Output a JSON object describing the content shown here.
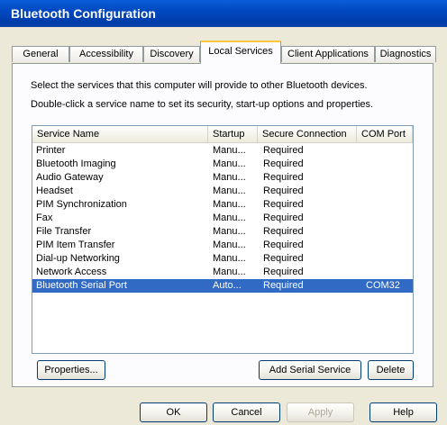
{
  "window": {
    "title": "Bluetooth Configuration"
  },
  "tabs": [
    {
      "label": "General"
    },
    {
      "label": "Accessibility"
    },
    {
      "label": "Discovery"
    },
    {
      "label": "Local Services"
    },
    {
      "label": "Client Applications"
    },
    {
      "label": "Diagnostics"
    }
  ],
  "panel": {
    "desc1": "Select the services that this computer will provide to other Bluetooth devices.",
    "desc2": "Double-click a service name to set its security, start-up options and properties."
  },
  "list": {
    "columns": [
      "Service Name",
      "Startup",
      "Secure Connection",
      "COM Port"
    ],
    "rows": [
      {
        "name": "Printer",
        "startup": "Manu...",
        "secure": "Required",
        "com": ""
      },
      {
        "name": "Bluetooth Imaging",
        "startup": "Manu...",
        "secure": "Required",
        "com": ""
      },
      {
        "name": "Audio Gateway",
        "startup": "Manu...",
        "secure": "Required",
        "com": ""
      },
      {
        "name": "Headset",
        "startup": "Manu...",
        "secure": "Required",
        "com": ""
      },
      {
        "name": "PIM Synchronization",
        "startup": "Manu...",
        "secure": "Required",
        "com": ""
      },
      {
        "name": "Fax",
        "startup": "Manu...",
        "secure": "Required",
        "com": ""
      },
      {
        "name": "File Transfer",
        "startup": "Manu...",
        "secure": "Required",
        "com": ""
      },
      {
        "name": "PIM Item Transfer",
        "startup": "Manu...",
        "secure": "Required",
        "com": ""
      },
      {
        "name": "Dial-up Networking",
        "startup": "Manu...",
        "secure": "Required",
        "com": ""
      },
      {
        "name": "Network Access",
        "startup": "Manu...",
        "secure": "Required",
        "com": ""
      },
      {
        "name": "Bluetooth Serial Port",
        "startup": "Auto...",
        "secure": "Required",
        "com": "COM32",
        "selected": true
      }
    ]
  },
  "buttons": {
    "properties": "Properties...",
    "add_serial": "Add Serial Service",
    "delete": "Delete",
    "ok": "OK",
    "cancel": "Cancel",
    "apply": "Apply",
    "help": "Help"
  }
}
